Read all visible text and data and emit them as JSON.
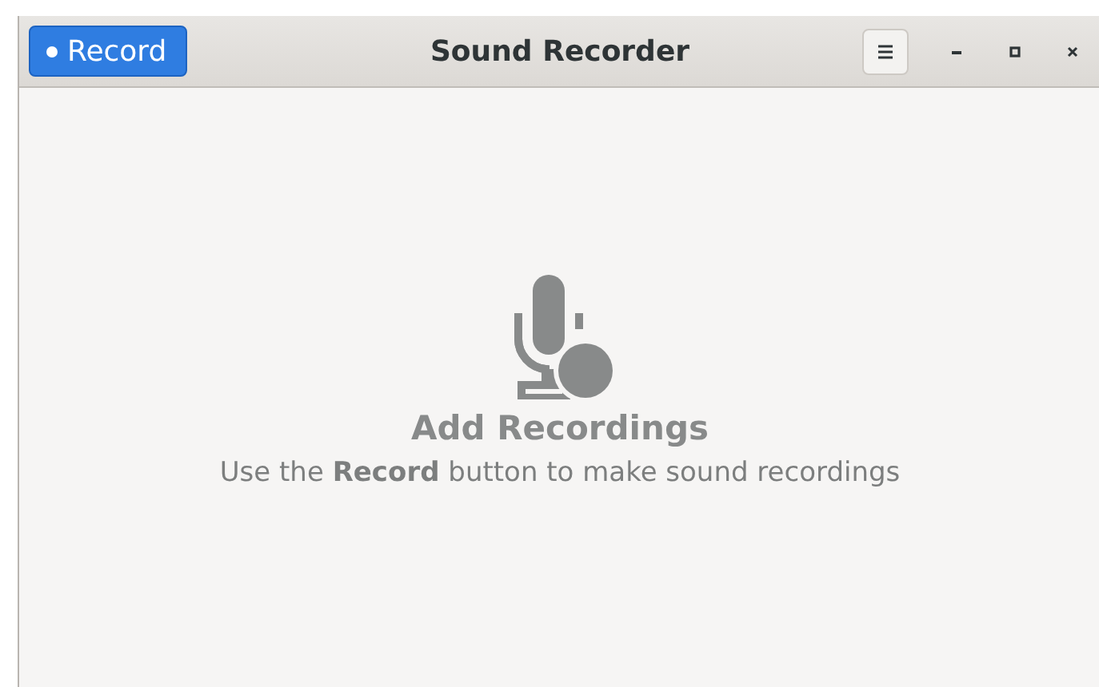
{
  "window": {
    "title": "Sound Recorder"
  },
  "header": {
    "record_button": "Record"
  },
  "empty_state": {
    "title": "Add Recordings",
    "message": "Use the **Record** button to make sound recordings"
  }
}
